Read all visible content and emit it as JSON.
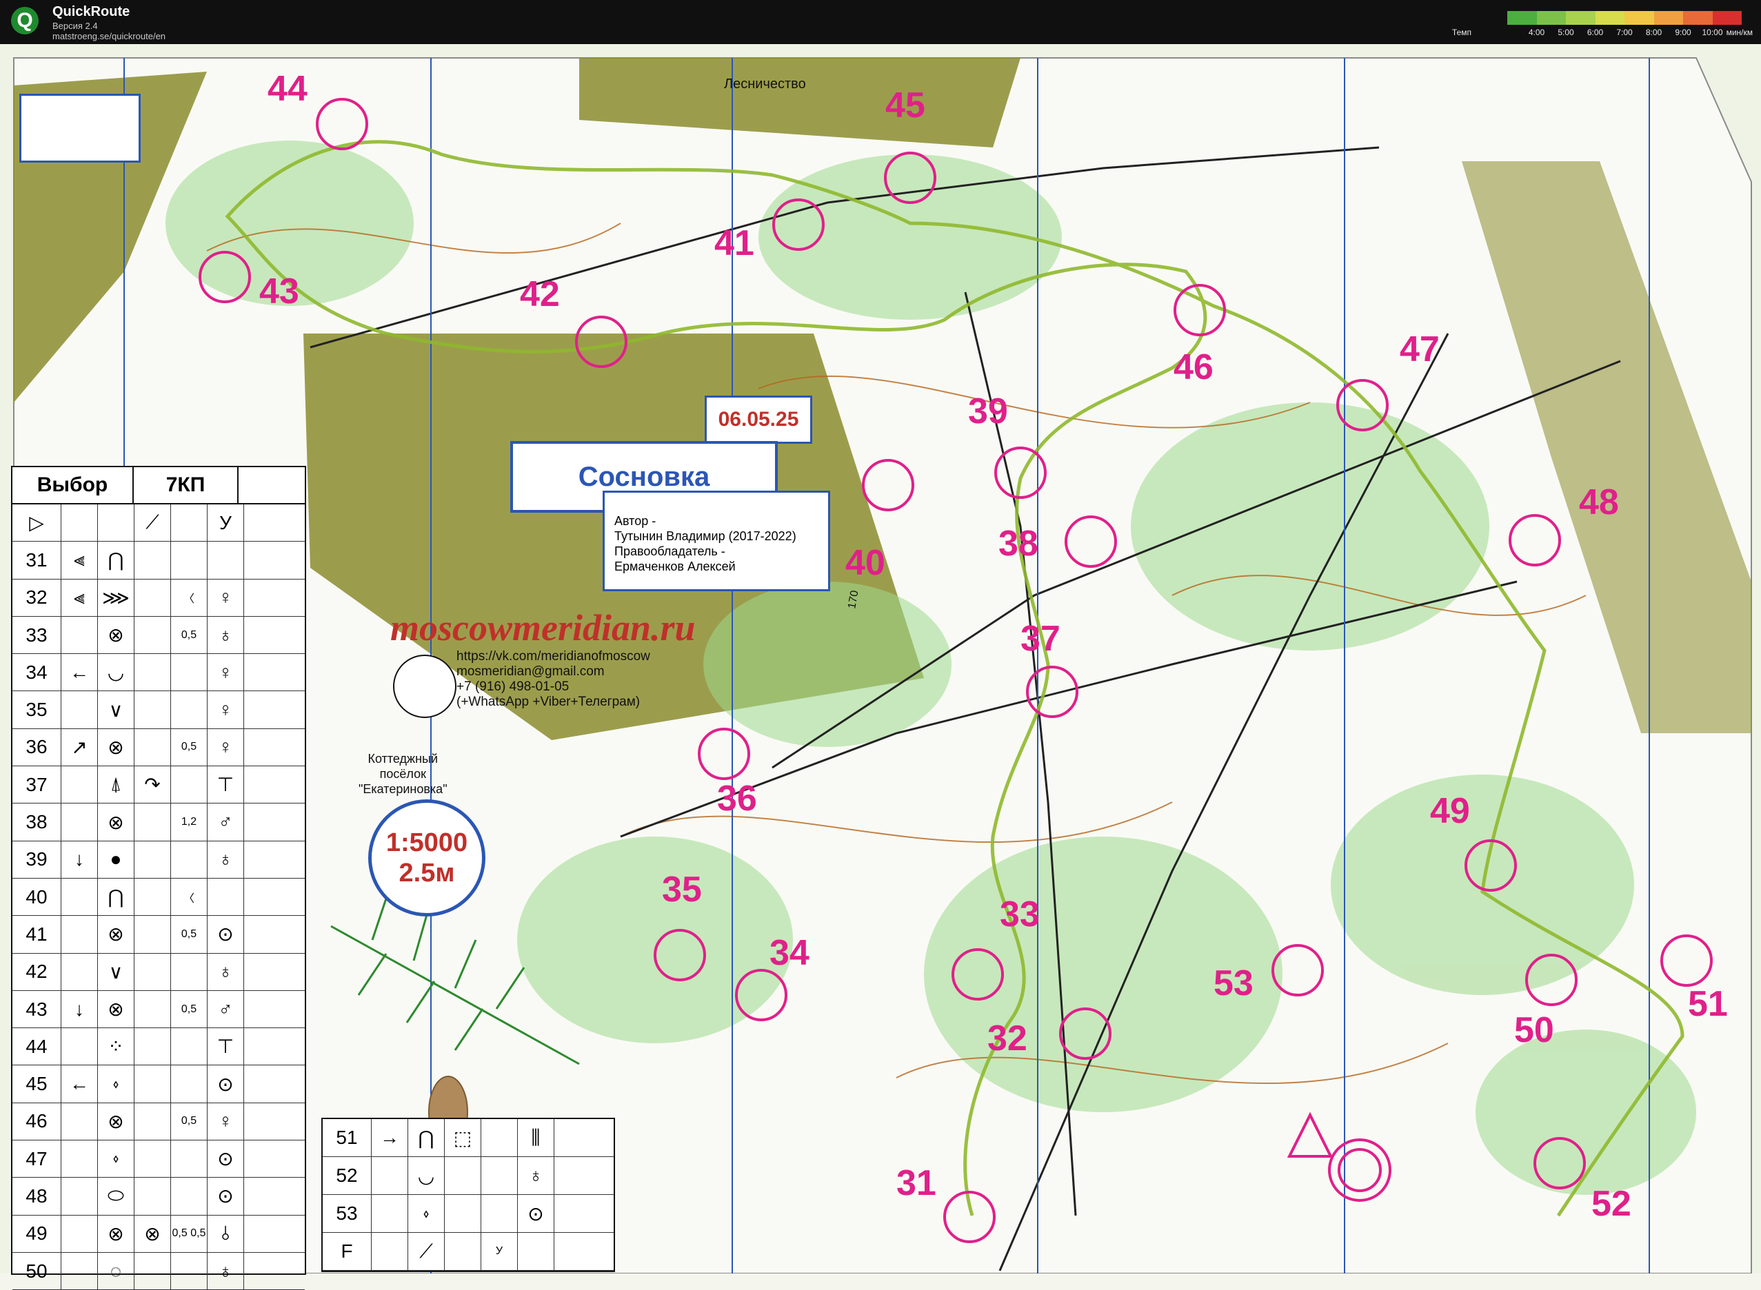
{
  "app": {
    "name": "QuickRoute",
    "version": "Версия 2.4",
    "url": "matstroeng.se/quickroute/en",
    "logo_letter": "Q"
  },
  "pace_legend": {
    "title": "Темп",
    "ticks": [
      "4:00",
      "5:00",
      "6:00",
      "7:00",
      "8:00",
      "9:00",
      "10:00"
    ],
    "unit": "мин/км",
    "colors": [
      "#4caf3f",
      "#7cc24a",
      "#a8d24d",
      "#d6dc4c",
      "#f0c845",
      "#f0a040",
      "#e86a38",
      "#d8302e"
    ]
  },
  "map": {
    "forestry_label": "Лесничество",
    "date": "06.05.25",
    "title": "Сосновка",
    "author_lines": [
      "Автор -",
      "Тутынин Владимир (2017-2022)",
      "Правообладатель -",
      "Ермаченков Алексей"
    ],
    "website": "moscowmeridian.ru",
    "contacts": [
      "https://vk.com/meridianofmoscow",
      "mosmeridian@gmail.com",
      "+7 (916) 498-01-05",
      "(+WhatsApp +Viber+Телеграм)"
    ],
    "village": [
      "Коттеджный",
      "посёлок",
      "\"Екатериновка\""
    ],
    "scale": "1:5000",
    "contour": "2.5м",
    "height_label": "170",
    "controls": [
      "31",
      "32",
      "33",
      "34",
      "35",
      "36",
      "37",
      "38",
      "39",
      "40",
      "41",
      "42",
      "43",
      "44",
      "45",
      "46",
      "47",
      "48",
      "49",
      "50",
      "51",
      "52",
      "53"
    ]
  },
  "description_table": {
    "header": [
      "Выбор",
      "7КП"
    ],
    "rows": [
      {
        "num": "▷",
        "c1": "",
        "c2": "",
        "c3": "⟋",
        "c4": "",
        "c5": "У",
        "c6": ""
      },
      {
        "num": "31",
        "c1": "⫷",
        "c2": "⋂",
        "c3": "",
        "c4": "",
        "c5": ""
      },
      {
        "num": "32",
        "c1": "⫷",
        "c2": "⋙",
        "c3": "",
        "c4": "〈",
        "c5": "♀"
      },
      {
        "num": "33",
        "c1": "",
        "c2": "⊗",
        "c3": "",
        "c4": "0,5",
        "c5": "♁"
      },
      {
        "num": "34",
        "c1": "←",
        "c2": "◡",
        "c3": "",
        "c4": "",
        "c5": "♀"
      },
      {
        "num": "35",
        "c1": "",
        "c2": "∨",
        "c3": "",
        "c4": "",
        "c5": "♀"
      },
      {
        "num": "36",
        "c1": "↗",
        "c2": "⊗",
        "c3": "",
        "c4": "0,5",
        "c5": "♀"
      },
      {
        "num": "37",
        "c1": "",
        "c2": "⍋",
        "c3": "↷",
        "c4": "",
        "c5": "⊤"
      },
      {
        "num": "38",
        "c1": "",
        "c2": "⊗",
        "c3": "",
        "c4": "1,2",
        "c5": "♂"
      },
      {
        "num": "39",
        "c1": "↓",
        "c2": "●",
        "c3": "",
        "c4": "",
        "c5": "♁"
      },
      {
        "num": "40",
        "c1": "",
        "c2": "⋂",
        "c3": "",
        "c4": "〈",
        "c5": ""
      },
      {
        "num": "41",
        "c1": "",
        "c2": "⊗",
        "c3": "",
        "c4": "0,5",
        "c5": "⊙"
      },
      {
        "num": "42",
        "c1": "",
        "c2": "∨",
        "c3": "",
        "c4": "",
        "c5": "♁"
      },
      {
        "num": "43",
        "c1": "↓",
        "c2": "⊗",
        "c3": "",
        "c4": "0,5",
        "c5": "♂"
      },
      {
        "num": "44",
        "c1": "",
        "c2": "⁘",
        "c3": "",
        "c4": "",
        "c5": "⊤"
      },
      {
        "num": "45",
        "c1": "←",
        "c2": "⬫",
        "c3": "",
        "c4": "",
        "c5": "⊙"
      },
      {
        "num": "46",
        "c1": "",
        "c2": "⊗",
        "c3": "",
        "c4": "0,5",
        "c5": "♀"
      },
      {
        "num": "47",
        "c1": "",
        "c2": "⬫",
        "c3": "",
        "c4": "",
        "c5": "⊙"
      },
      {
        "num": "48",
        "c1": "",
        "c2": "⬭",
        "c3": "",
        "c4": "",
        "c5": "⊙"
      },
      {
        "num": "49",
        "c1": "",
        "c2": "⊗",
        "c3": "⊗",
        "c4": "0,5 0,5",
        "c5": "⫰"
      },
      {
        "num": "50",
        "c1": "",
        "c2": "◌",
        "c3": "",
        "c4": "",
        "c5": "♁"
      }
    ]
  },
  "description_table_2": {
    "rows": [
      {
        "num": "51",
        "c1": "→",
        "c2": "⋂",
        "c3": "⬚",
        "c4": "",
        "c5": "⫼"
      },
      {
        "num": "52",
        "c1": "",
        "c2": "◡",
        "c3": "",
        "c4": "",
        "c5": "♁"
      },
      {
        "num": "53",
        "c1": "",
        "c2": "⬫",
        "c3": "",
        "c4": "",
        "c5": "⊙"
      },
      {
        "num": "F",
        "c1": "",
        "c2": "⟋",
        "c3": "",
        "c4": "У",
        "c5": ""
      }
    ]
  }
}
